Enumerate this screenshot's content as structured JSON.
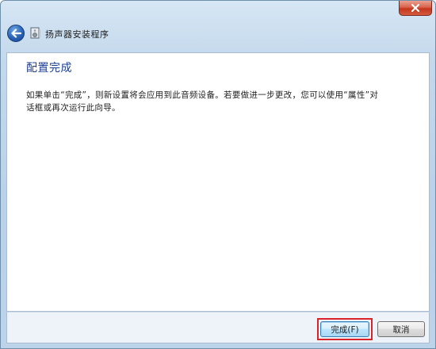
{
  "window": {
    "title": "扬声器安装程序"
  },
  "content": {
    "heading": "配置完成",
    "body": "如果单击“完成”，则新设置将会应用到此音频设备。若要做进一步更改，您可以使用“属性”对话框或再次运行此向导。"
  },
  "buttons": {
    "finish_label": "完成(F)",
    "cancel_label": "取消"
  },
  "icons": {
    "close": "close-icon",
    "back": "back-arrow-icon",
    "app": "speaker-setup-icon"
  },
  "colors": {
    "heading": "#1c3f94",
    "highlight": "#d9222a",
    "titlebar": "#c3d8ec"
  }
}
